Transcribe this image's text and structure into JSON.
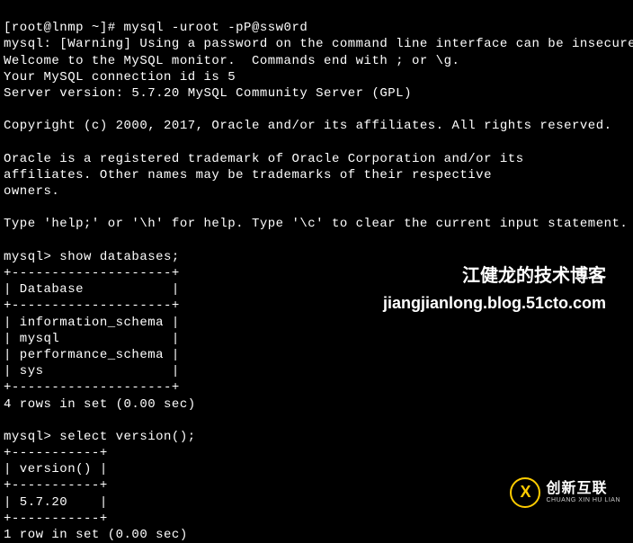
{
  "terminal": {
    "prompt_line": "[root@lnmp ~]# mysql -uroot -pP@ssw0rd",
    "warning": "mysql: [Warning] Using a password on the command line interface can be insecure.",
    "welcome": "Welcome to the MySQL monitor.  Commands end with ; or \\g.",
    "connection_id": "Your MySQL connection id is 5",
    "server_version": "Server version: 5.7.20 MySQL Community Server (GPL)",
    "copyright": "Copyright (c) 2000, 2017, Oracle and/or its affiliates. All rights reserved.",
    "trademark_1": "Oracle is a registered trademark of Oracle Corporation and/or its",
    "trademark_2": "affiliates. Other names may be trademarks of their respective",
    "trademark_3": "owners.",
    "help_line": "Type 'help;' or '\\h' for help. Type '\\c' to clear the current input statement.",
    "query1": {
      "prompt": "mysql> show databases;",
      "border_top": "+--------------------+",
      "header": "| Database           |",
      "rows": [
        "| information_schema |",
        "| mysql              |",
        "| performance_schema |",
        "| sys                |"
      ],
      "result": "4 rows in set (0.00 sec)"
    },
    "query2": {
      "prompt": "mysql> select version();",
      "border_top": "+-----------+",
      "header": "| version() |",
      "row": "| 5.7.20    |",
      "result": "1 row in set (0.00 sec)"
    }
  },
  "watermark": {
    "line1": "江健龙的技术博客",
    "line2": "jiangjianlong.blog.51cto.com"
  },
  "logo": {
    "letter": "X",
    "main": "创新互联",
    "sub": "CHUANG XIN HU LIAN"
  }
}
